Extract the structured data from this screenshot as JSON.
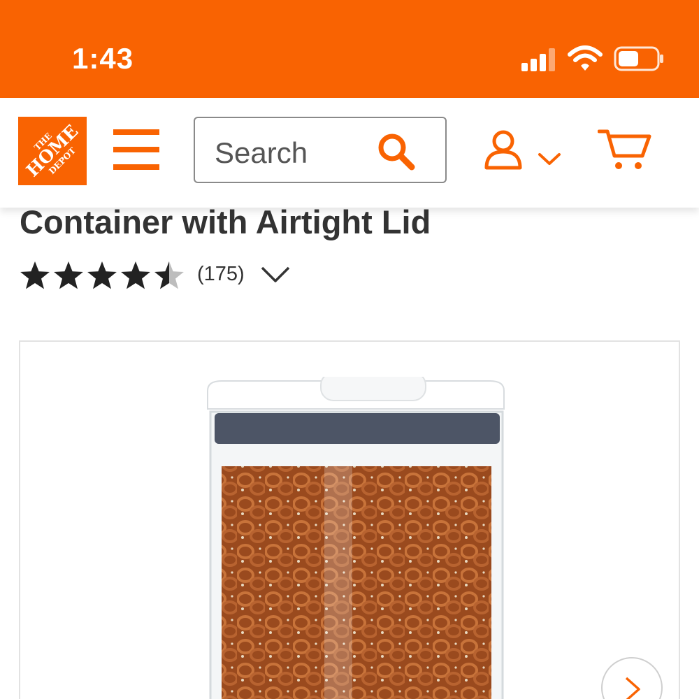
{
  "status_bar": {
    "time": "1:43",
    "background_color": "#f96302",
    "icons": [
      "cellular-signal-icon",
      "wifi-icon",
      "battery-icon"
    ]
  },
  "header": {
    "logo": {
      "line1": "THE",
      "line2": "HOME",
      "line3": "DEPOT",
      "color": "#f96302"
    },
    "menu_icon": "hamburger-menu-icon",
    "search": {
      "placeholder": "Search",
      "icon": "search-icon"
    },
    "account_icon": "user-icon",
    "account_dropdown_icon": "chevron-down-icon",
    "cart_icon": "cart-icon",
    "accent_color": "#f96302"
  },
  "product": {
    "title": "Container with Airtight Lid",
    "rating": {
      "value": 4.5,
      "max": 5,
      "count_label": "(175)"
    },
    "gallery": {
      "next_icon": "chevron-right-icon"
    }
  }
}
